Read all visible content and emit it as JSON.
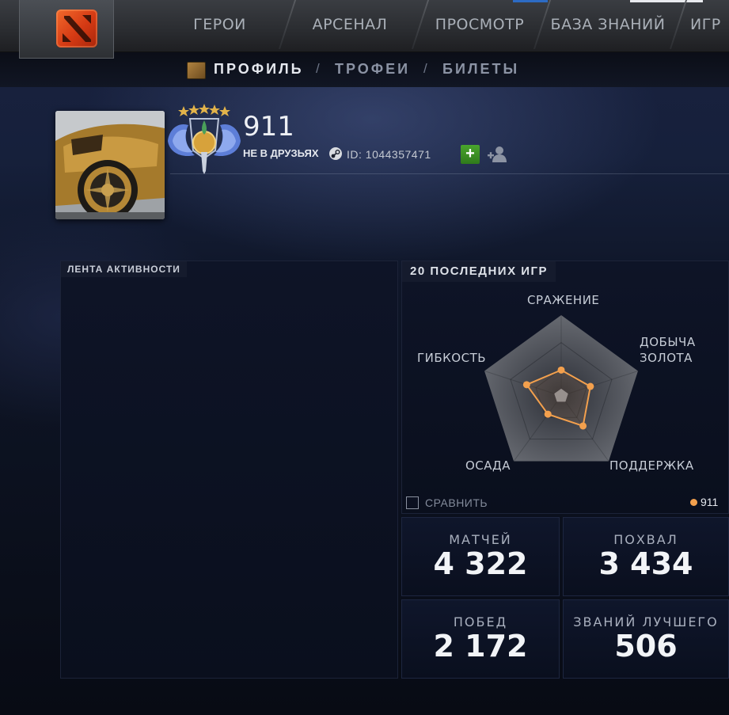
{
  "nav": {
    "tabs": [
      {
        "label": "ГЕРОИ"
      },
      {
        "label": "АРСЕНАЛ"
      },
      {
        "label": "ПРОСМОТР"
      },
      {
        "label": "БАЗА ЗНАНИЙ"
      },
      {
        "label": "ИГР"
      }
    ]
  },
  "subnav": {
    "items": [
      {
        "label": "ПРОФИЛЬ",
        "active": true
      },
      {
        "label": "ТРОФЕИ",
        "active": false
      },
      {
        "label": "БИЛЕТЫ",
        "active": false
      }
    ],
    "separator": "/"
  },
  "profile": {
    "name": "911",
    "friend_status": "НЕ В ДРУЗЬЯХ",
    "steam_id": "ID: 1044357471",
    "add_symbol": "+",
    "rank_icon": "immortal-medal-icon"
  },
  "feed": {
    "title": "ЛЕНТА АКТИВНОСТИ"
  },
  "recent_games": {
    "title": "20 ПОСЛЕДНИХ ИГР",
    "axes": [
      {
        "label": "СРАЖЕНИЕ"
      },
      {
        "label": "ДОБЫЧА\nЗОЛОТА"
      },
      {
        "label": "ПОДДЕРЖКА"
      },
      {
        "label": "ОСАДА"
      },
      {
        "label": "ГИБКОСТЬ"
      }
    ],
    "compare_label": "СРАВНИТЬ",
    "legend_name": "911",
    "player_color": "#f3a04d"
  },
  "chart_data": {
    "type": "radar",
    "axes": [
      "СРАЖЕНИЕ",
      "ДОБЫЧА ЗОЛОТА",
      "ПОДДЕРЖКА",
      "ОСАДА",
      "ГИБКОСТЬ"
    ],
    "series": [
      {
        "name": "911",
        "values": [
          0.32,
          0.38,
          0.46,
          0.28,
          0.45
        ]
      }
    ],
    "range": [
      0,
      1
    ]
  },
  "stats": [
    {
      "label": "МАТЧЕЙ",
      "value": "4 322"
    },
    {
      "label": "ПОХВАЛ",
      "value": "3 434"
    },
    {
      "label": "ПОБЕД",
      "value": "2 172"
    },
    {
      "label": "ЗВАНИЙ ЛУЧШЕГО",
      "value": "506"
    }
  ]
}
